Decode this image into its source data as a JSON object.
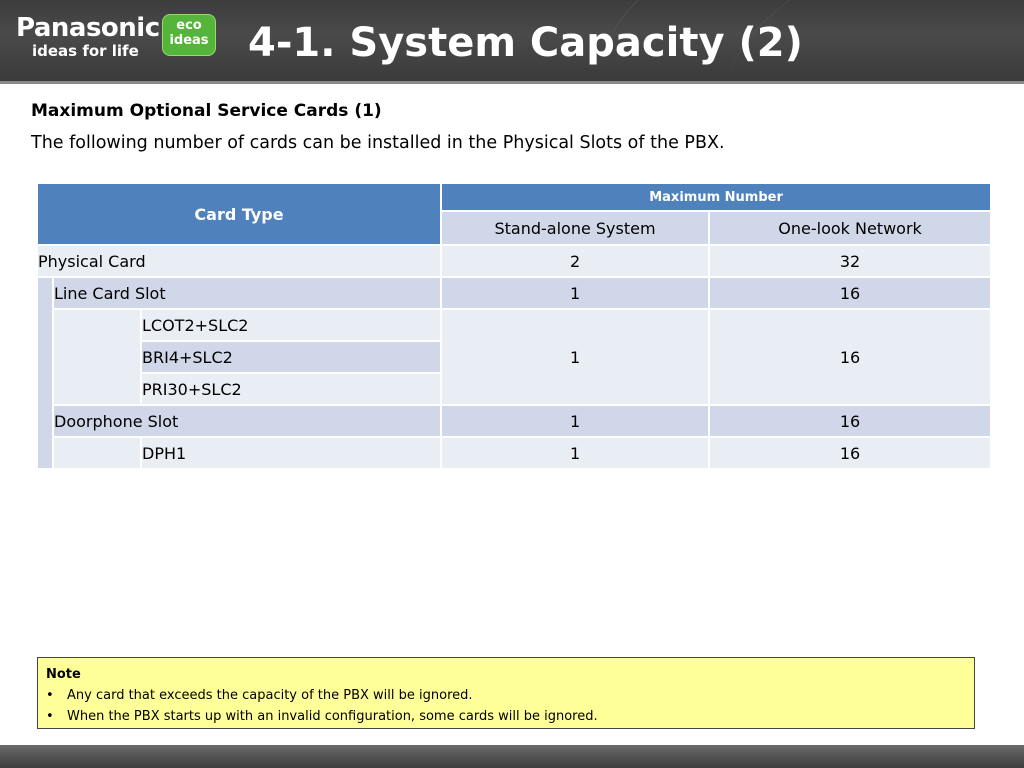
{
  "header": {
    "brand_name": "Panasonic",
    "brand_tagline": "ideas for life",
    "eco_line1": "eco",
    "eco_line2": "ideas",
    "title": "4-1. System Capacity (2)"
  },
  "content": {
    "subtitle": "Maximum Optional Service Cards (1)",
    "description": "The following number of cards can be installed in the Physical Slots of the PBX."
  },
  "table": {
    "header_card_type": "Card Type",
    "header_max": "Maximum Number",
    "header_standalone": "Stand-alone System",
    "header_onelook": "One-look Network",
    "rows": {
      "physical_card": {
        "label": "Physical Card",
        "standalone": "2",
        "onelook": "32"
      },
      "line_card_slot": {
        "label": "Line Card Slot",
        "standalone": "1",
        "onelook": "16"
      },
      "line_group": {
        "cards": [
          "LCOT2+SLC2",
          "BRI4+SLC2",
          "PRI30+SLC2"
        ],
        "standalone": "1",
        "onelook": "16"
      },
      "doorphone_slot": {
        "label": "Doorphone Slot",
        "standalone": "1",
        "onelook": "16"
      },
      "dph1": {
        "label": "DPH1",
        "standalone": "1",
        "onelook": "16"
      }
    }
  },
  "note": {
    "title": "Note",
    "bullet_symbol": "•",
    "items": [
      "Any card that exceeds the capacity of the PBX will be ignored.",
      "When the PBX starts up with an invalid configuration, some cards will be ignored."
    ]
  },
  "colors": {
    "header_blue": "#4f81bd",
    "row_dark": "#cfd7e8",
    "row_light": "#e9edf4",
    "note_bg": "#ffff99",
    "eco_green": "#55b43a"
  }
}
